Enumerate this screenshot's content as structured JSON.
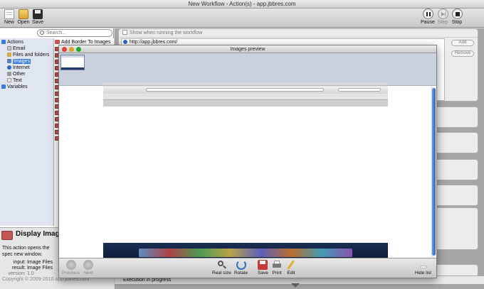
{
  "window": {
    "title": "New Workflow - Action(s) - app.jbbres.com"
  },
  "toolbar": {
    "new_label": "New",
    "open_label": "Open",
    "save_label": "Save",
    "pause_label": "Pause",
    "step_label": "Step",
    "stop_label": "Stop"
  },
  "library": {
    "search_placeholder": "Search...",
    "actions_label": "Actions",
    "categories": [
      "Email",
      "Files and folders",
      "Images",
      "Internet",
      "Other",
      "Text"
    ],
    "variables_label": "Variables"
  },
  "action_list": {
    "first_item": "Add Border To Images"
  },
  "description": {
    "title": "Display Image",
    "text": "This action opens the spec new window.",
    "input_label": "input:",
    "input_value": "Image Files",
    "result_label": "result:",
    "result_value": "Image Files",
    "version_label": "version:",
    "version_value": "1.0",
    "copyright": "Copyright © 2009-2010 app.jbbres.com"
  },
  "workflow": {
    "show_when_running": "Show when running the workflow",
    "url": "http://app.jbbres.com/",
    "add_label": "Add",
    "remove_label": "Remove",
    "execution_status": "Execution in progress"
  },
  "preview": {
    "title": "Images preview",
    "previous_label": "Previous",
    "next_label": "Next",
    "real_size_label": "Real size",
    "rotate_label": "Rotate",
    "save_label": "Save",
    "print_label": "Print",
    "edit_label": "Edit",
    "hide_list_label": "Hide list"
  },
  "colors": {
    "selection": "#3d7bd8",
    "stop": "#c24545",
    "preview_strip": "#c9d1de"
  }
}
